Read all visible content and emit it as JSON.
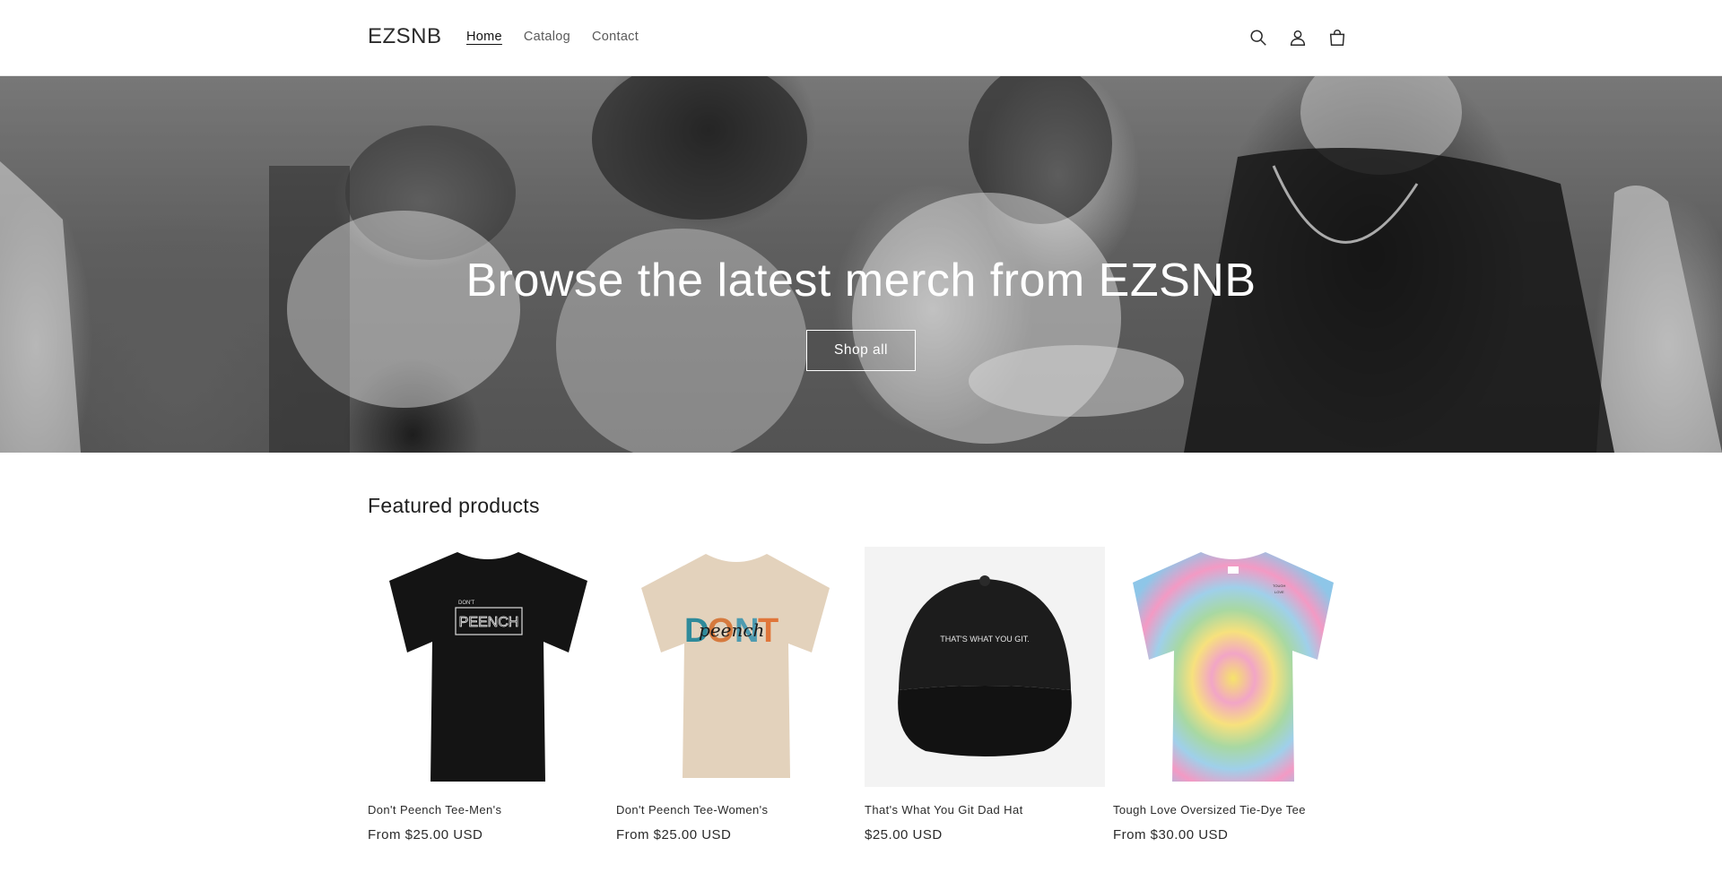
{
  "header": {
    "logo": "EZSNB",
    "nav": [
      {
        "label": "Home",
        "active": true
      },
      {
        "label": "Catalog",
        "active": false
      },
      {
        "label": "Contact",
        "active": false
      }
    ],
    "icons": [
      "search-icon",
      "account-icon",
      "cart-icon"
    ]
  },
  "hero": {
    "title": "Browse the latest merch from EZSNB",
    "button_label": "Shop all"
  },
  "featured": {
    "title": "Featured products",
    "products": [
      {
        "name": "Don't Peench Tee-Men's",
        "price": "From $25.00 USD",
        "image_text": "DON'T PEENCH",
        "color": "#141414"
      },
      {
        "name": "Don't Peench Tee-Women's",
        "price": "From $25.00 USD",
        "image_text": "DONT",
        "color": "#e3d2bc"
      },
      {
        "name": "That's What You Git Dad Hat",
        "price": "$25.00 USD",
        "image_text": "THAT'S WHAT YOU GIT.",
        "color": "#1c1c1c"
      },
      {
        "name": "Tough Love Oversized Tie-Dye Tee",
        "price": "From $30.00 USD",
        "image_text": "",
        "color": "#f4a7c8"
      }
    ]
  }
}
